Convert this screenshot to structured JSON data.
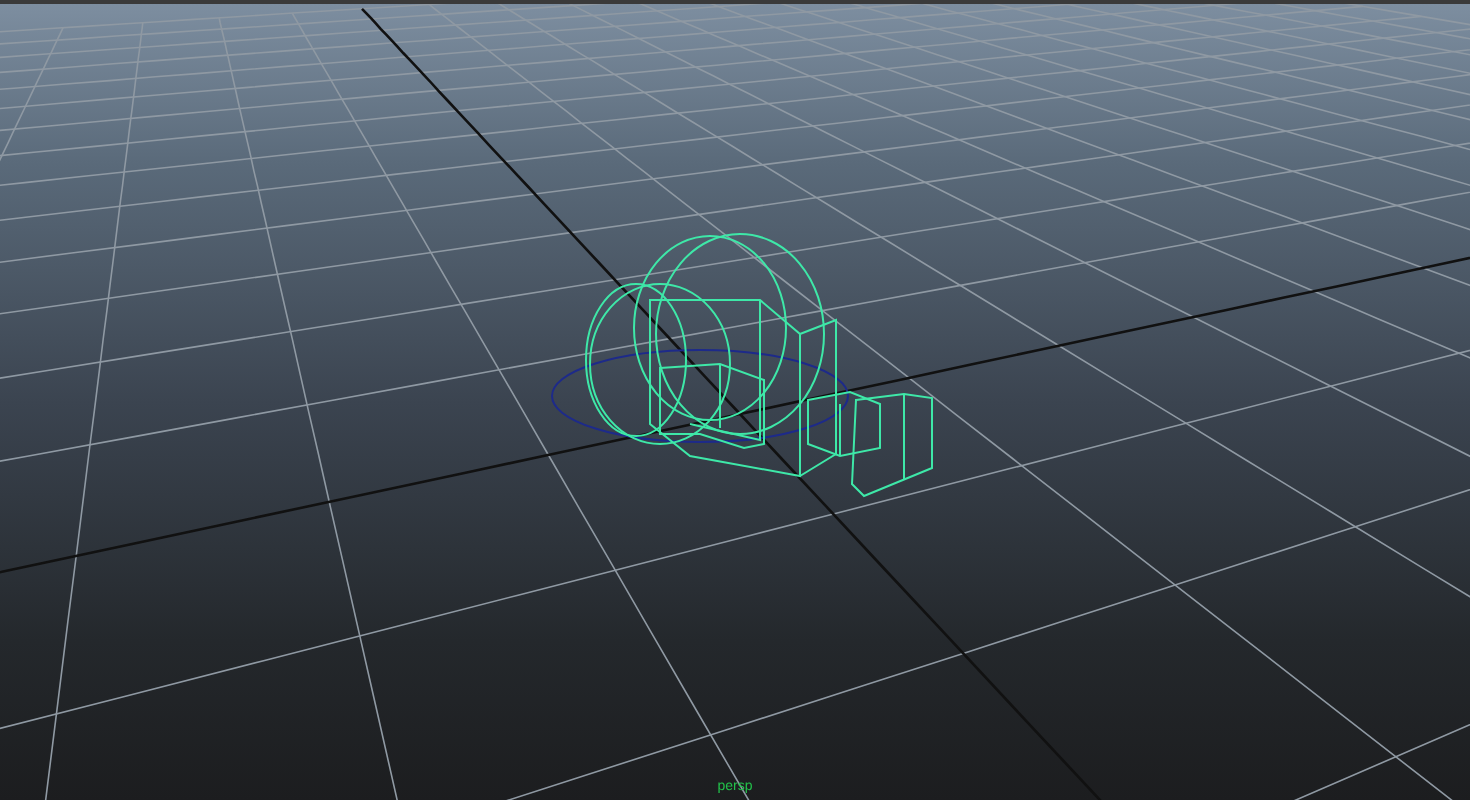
{
  "viewport": {
    "camera_label": "persp"
  }
}
